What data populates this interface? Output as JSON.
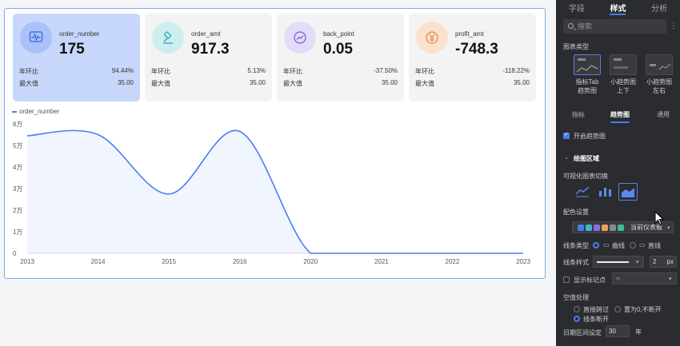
{
  "cards": [
    {
      "title": "order_number",
      "value": "175",
      "row1_label": "年环比",
      "row1_value": "94.44%",
      "row2_label": "最大值",
      "row2_value": "35.00",
      "color": "#4a7cf0",
      "icon": "chart-monitor-icon"
    },
    {
      "title": "order_amt",
      "value": "917.3",
      "row1_label": "年环比",
      "row1_value": "5.13%",
      "row2_label": "最大值",
      "row2_value": "35.00",
      "color": "#3fb8c8",
      "icon": "auction-hammer-icon"
    },
    {
      "title": "back_point",
      "value": "0.05",
      "row1_label": "年环比",
      "row1_value": "-37.50%",
      "row2_label": "最大值",
      "row2_value": "35.00",
      "color": "#8a6fe0",
      "icon": "trend-circle-icon"
    },
    {
      "title": "profit_amt",
      "value": "-748.3",
      "row1_label": "年环比",
      "row1_value": "-118.22%",
      "row2_label": "最大值",
      "row2_value": "35.00",
      "color": "#f0a060",
      "icon": "yen-icon"
    }
  ],
  "chart_data": {
    "type": "area",
    "x": [
      "2013",
      "2014",
      "2015",
      "2016",
      "2020",
      "2021",
      "2022",
      "2023"
    ],
    "series": [
      {
        "name": "order_number",
        "values": [
          54500,
          55000,
          27500,
          56500,
          0,
          0,
          0,
          0
        ]
      }
    ],
    "y_ticks": [
      "0",
      "1万",
      "2万",
      "3万",
      "4万",
      "5万",
      "6万"
    ],
    "ylim": [
      0,
      60000
    ],
    "legend": "top-left",
    "grid": false,
    "line_color": "#4a7cf0"
  },
  "panel": {
    "tabs": [
      "字段",
      "样式",
      "分析"
    ],
    "active_tab": "样式",
    "search_placeholder": "搜索",
    "chart_type_label": "图表类型",
    "chart_types": [
      "指标Tab\n趋势图",
      "小趋势图\n上下",
      "小趋势图\n左右"
    ],
    "subtabs": [
      "指标",
      "趋势图",
      "通用"
    ],
    "enable_trend": "开启趋势图",
    "draw_area": "绘图区域",
    "vis_switch": "可视化图表切换",
    "color_settings": "配色设置",
    "color_theme": "当前仪表板",
    "swatches": [
      "#4a7cf0",
      "#3fb8c8",
      "#8a6fe0",
      "#f0a060",
      "#888a90",
      "#3cc08a"
    ],
    "line_type_label": "线条类型",
    "line_curve": "曲线",
    "line_straight": "直线",
    "line_style_label": "线条样式",
    "line_width": "2",
    "line_unit": "px",
    "show_markers": "显示标记点",
    "null_handling": "空值处理",
    "null_opts": [
      "直接跨过",
      "置为0,不断开",
      "线条断开"
    ],
    "date_range_label": "日期区间设定",
    "date_range_value": "30",
    "date_range_unit": "年"
  }
}
